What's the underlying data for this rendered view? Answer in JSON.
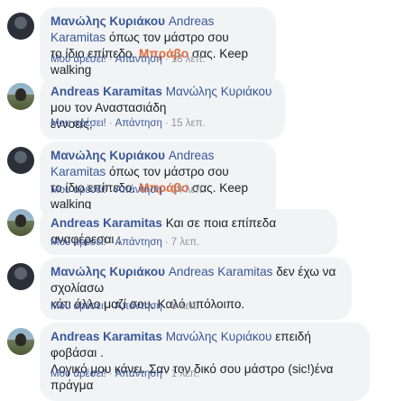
{
  "comments": [
    {
      "avatar": "user-avatar-dark",
      "author": "Μανώλης Κυριάκου",
      "mention": "Andreas Karamitas",
      "text_before": " όπως τον μάστρο σου",
      "text_line2_before": "το ίδιο επίπεδο. ",
      "highlight": "Μπράβο",
      "text_after": " σας. Keep walking",
      "like": "Μου αρέσει!",
      "reply": "Απάντηση",
      "time": "18 λεπ."
    },
    {
      "avatar": "user-avatar-landscape",
      "author": "Andreas Karamitas",
      "mention": "Μανώλης Κυριάκου",
      "text_before": " μου τον Αναστασιάδη",
      "text_line2_before": "εννοείς;",
      "like": "Μου αρέσει!",
      "reply": "Απάντηση",
      "time": "15 λεπ."
    },
    {
      "avatar": "user-avatar-dark",
      "author": "Μανώλης Κυριάκου",
      "mention": "Andreas Karamitas",
      "text_before": " όπως τον μάστρο σου",
      "text_line2_before": "το ίδιο επίπεδο. ",
      "highlight": "Μπράβο",
      "text_after": " σας. Keep walking",
      "like": "Μου αρέσει!",
      "reply": "Απάντηση",
      "time": "14 λεπ."
    },
    {
      "avatar": "user-avatar-landscape",
      "author": "Andreas Karamitas",
      "text_before": " Και σε ποια επίπεδα αναφέρεσαι ;",
      "like": "Μου αρέσει!",
      "reply": "Απάντηση",
      "time": "7 λεπ."
    },
    {
      "avatar": "user-avatar-dark",
      "author": "Μανώλης Κυριάκου",
      "mention": "Andreas Karamitas",
      "text_before": " δεν έχω να σχολίασω",
      "text_line2_before": "κάτι άλλο μαζί σου. Καλό υπόλοιπο.",
      "like": "Μου αρέσει!",
      "reply": "Απάντηση",
      "time": "5 λεπ."
    },
    {
      "avatar": "user-avatar-landscape",
      "author": "Andreas Karamitas",
      "mention": "Μανώλης Κυριάκου",
      "text_before": " επειδή φοβάσαι .",
      "text_line2_before": "Λογικό μου κάνει. Σαν τον δικό σου μάστρο (sic!)ένα πράγμα",
      "like": "Μου αρέσει!",
      "reply": "Απάντηση",
      "time": "1 λεπ."
    }
  ]
}
